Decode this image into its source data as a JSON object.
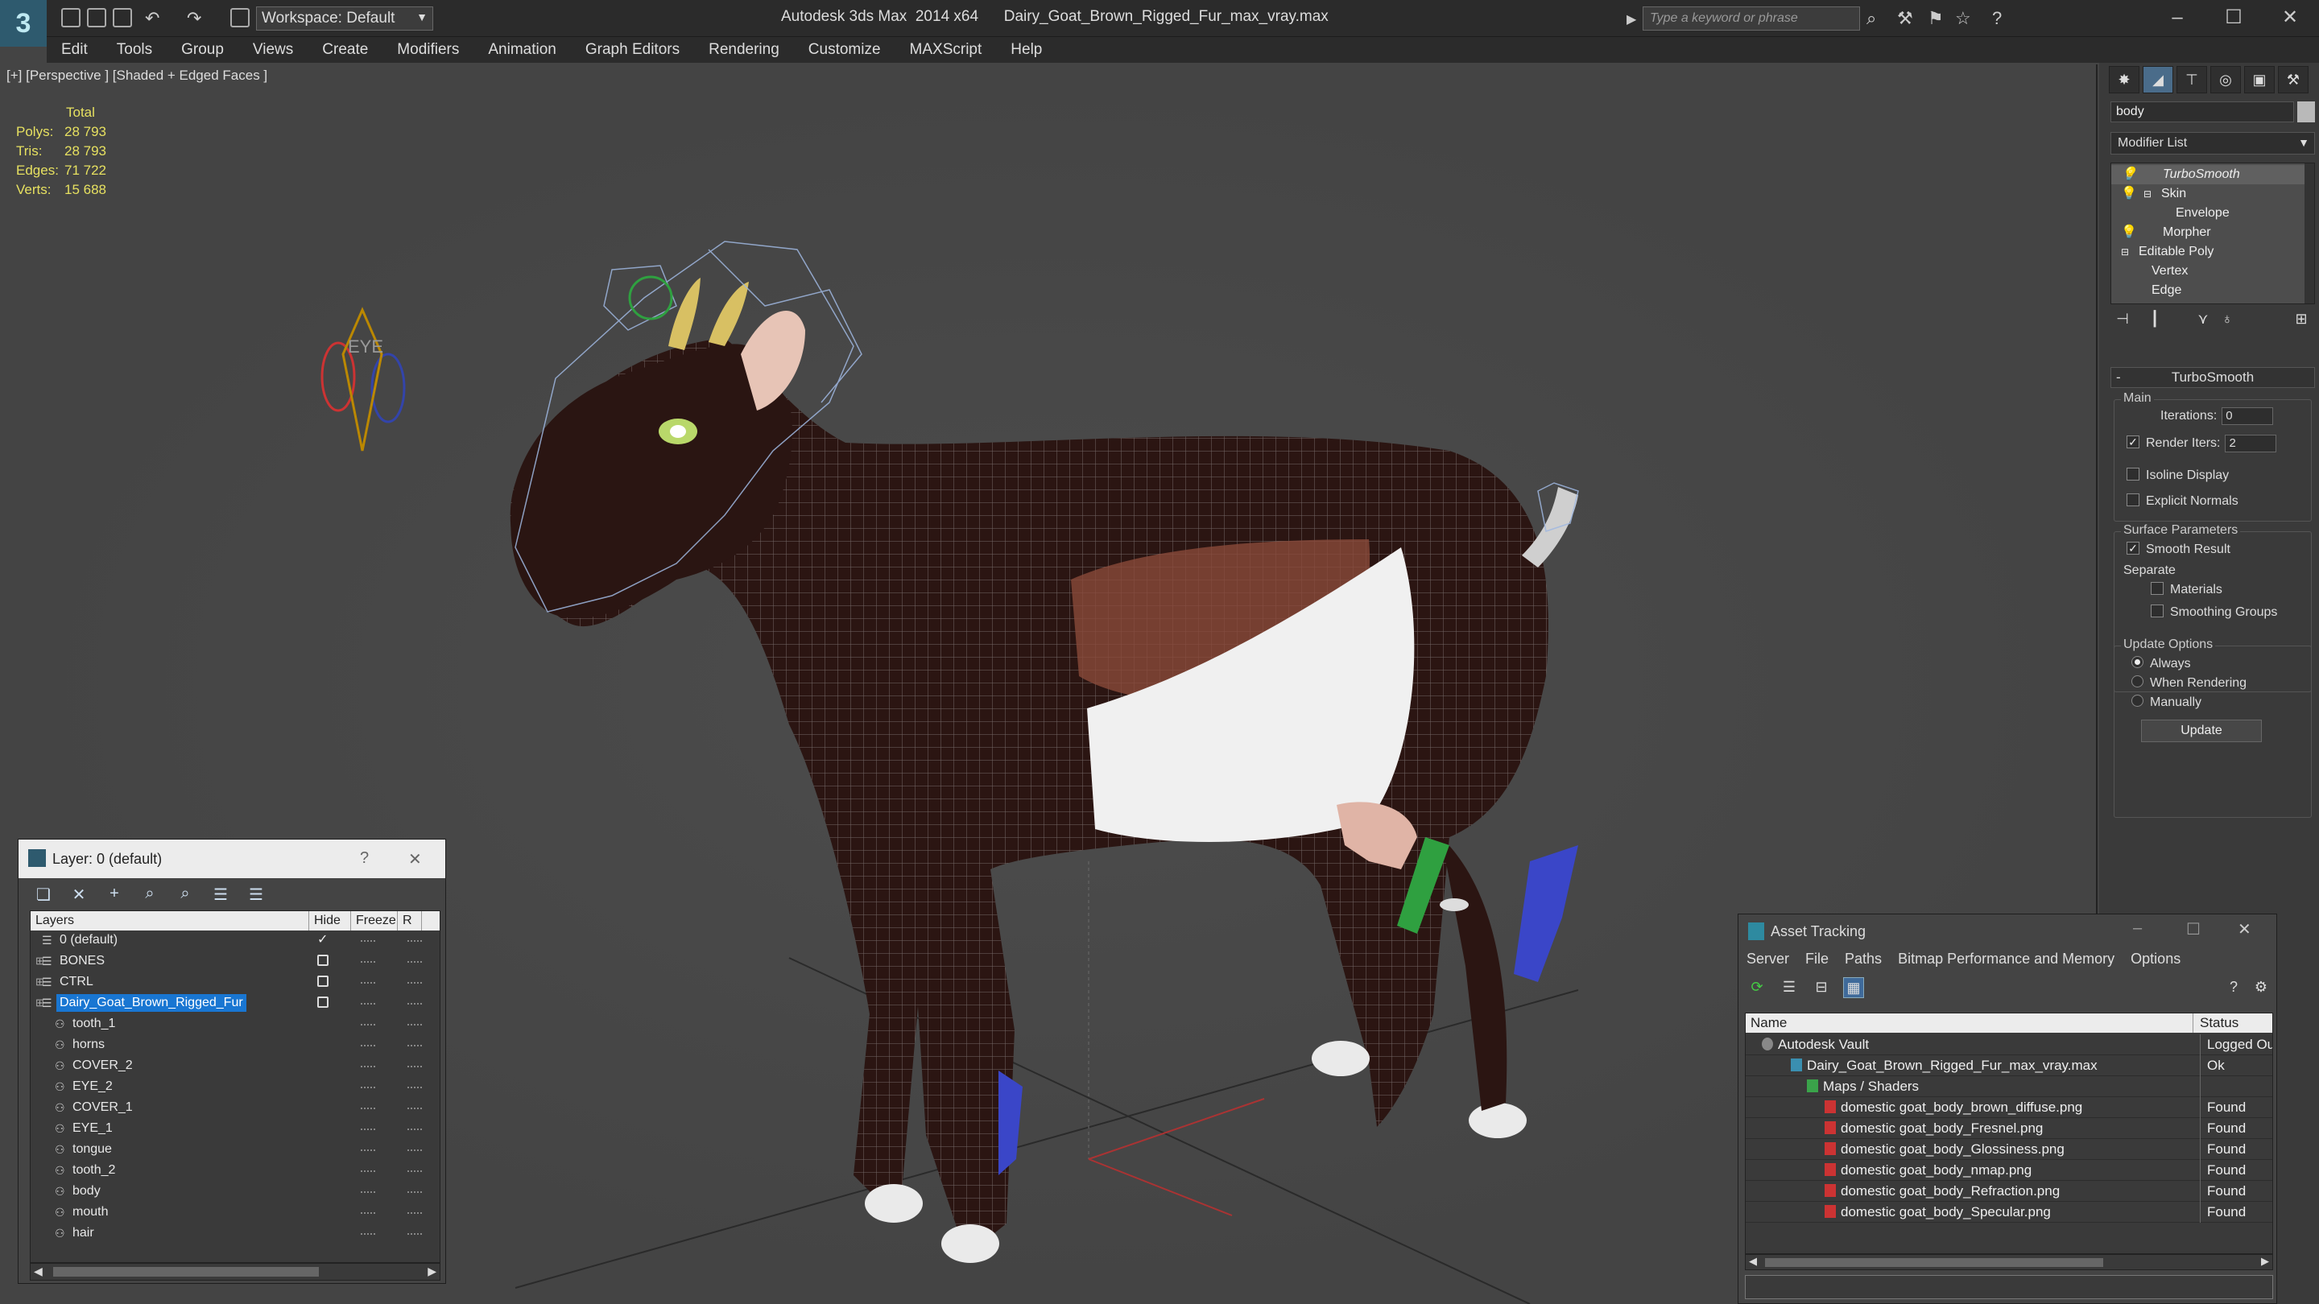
{
  "titlebar": {
    "workspace": "Workspace: Default",
    "app_title": "Autodesk 3ds Max  2014 x64",
    "file_title": "Dairy_Goat_Brown_Rigged_Fur_max_vray.max",
    "search_placeholder": "Type a keyword or phrase"
  },
  "menu": [
    "Edit",
    "Tools",
    "Group",
    "Views",
    "Create",
    "Modifiers",
    "Animation",
    "Graph Editors",
    "Rendering",
    "Customize",
    "MAXScript",
    "Help"
  ],
  "viewport": {
    "label": "[+] [Perspective ] [Shaded + Edged Faces ]",
    "gizmo_text": "EYE",
    "stats": {
      "header": "Total",
      "rows": [
        {
          "label": "Polys:",
          "value": "28 793"
        },
        {
          "label": "Tris:",
          "value": "28 793"
        },
        {
          "label": "Edges:",
          "value": "71 722"
        },
        {
          "label": "Verts:",
          "value": "15 688"
        }
      ]
    }
  },
  "command_panel": {
    "object_name": "body",
    "modifier_list": "Modifier List",
    "stack": [
      "TurboSmooth",
      "Skin",
      "Envelope",
      "Morpher",
      "Editable Poly",
      "Vertex",
      "Edge"
    ],
    "rollout_title": "TurboSmooth",
    "main_group": "Main",
    "iterations_label": "Iterations:",
    "iterations_value": "0",
    "render_iters_label": "Render Iters:",
    "render_iters_value": "2",
    "isoline": "Isoline Display",
    "explicit_normals": "Explicit Normals",
    "surface_group": "Surface Parameters",
    "smooth_result": "Smooth Result",
    "separate": "Separate",
    "materials": "Materials",
    "smoothing_groups": "Smoothing Groups",
    "update_group": "Update Options",
    "always": "Always",
    "when_rendering": "When Rendering",
    "manually": "Manually",
    "update_button": "Update"
  },
  "layer_dialog": {
    "title": "Layer: 0 (default)",
    "help": "?",
    "columns": [
      "Layers",
      "Hide",
      "Freeze",
      "R"
    ],
    "rows": [
      {
        "name": "0 (default)",
        "level": 0,
        "checked": true
      },
      {
        "name": "BONES",
        "level": 0,
        "expander": true
      },
      {
        "name": "CTRL",
        "level": 0,
        "expander": true
      },
      {
        "name": "Dairy_Goat_Brown_Rigged_Fur",
        "level": 0,
        "expander": true,
        "selected": true
      },
      {
        "name": "tooth_1",
        "level": 1
      },
      {
        "name": "horns",
        "level": 1
      },
      {
        "name": "COVER_2",
        "level": 1
      },
      {
        "name": "EYE_2",
        "level": 1
      },
      {
        "name": "COVER_1",
        "level": 1
      },
      {
        "name": "EYE_1",
        "level": 1
      },
      {
        "name": "tongue",
        "level": 1
      },
      {
        "name": "tooth_2",
        "level": 1
      },
      {
        "name": "body",
        "level": 1
      },
      {
        "name": "mouth",
        "level": 1
      },
      {
        "name": "hair",
        "level": 1
      }
    ]
  },
  "asset_dialog": {
    "title": "Asset Tracking",
    "menu": [
      "Server",
      "File",
      "Paths",
      "Bitmap Performance and Memory",
      "Options"
    ],
    "columns": [
      "Name",
      "Status"
    ],
    "rows": [
      {
        "name": "Autodesk Vault",
        "status": "Logged Out",
        "icon": "vault"
      },
      {
        "name": "Dairy_Goat_Brown_Rigged_Fur_max_vray.max",
        "status": "Ok",
        "icon": "file"
      },
      {
        "name": "Maps / Shaders",
        "status": "",
        "icon": "folder"
      },
      {
        "name": "domestic goat_body_brown_diffuse.png",
        "status": "Found",
        "icon": "png"
      },
      {
        "name": "domestic goat_body_Fresnel.png",
        "status": "Found",
        "icon": "png"
      },
      {
        "name": "domestic goat_body_Glossiness.png",
        "status": "Found",
        "icon": "png"
      },
      {
        "name": "domestic goat_body_nmap.png",
        "status": "Found",
        "icon": "png"
      },
      {
        "name": "domestic goat_body_Refraction.png",
        "status": "Found",
        "icon": "png"
      },
      {
        "name": "domestic goat_body_Specular.png",
        "status": "Found",
        "icon": "png"
      }
    ]
  }
}
